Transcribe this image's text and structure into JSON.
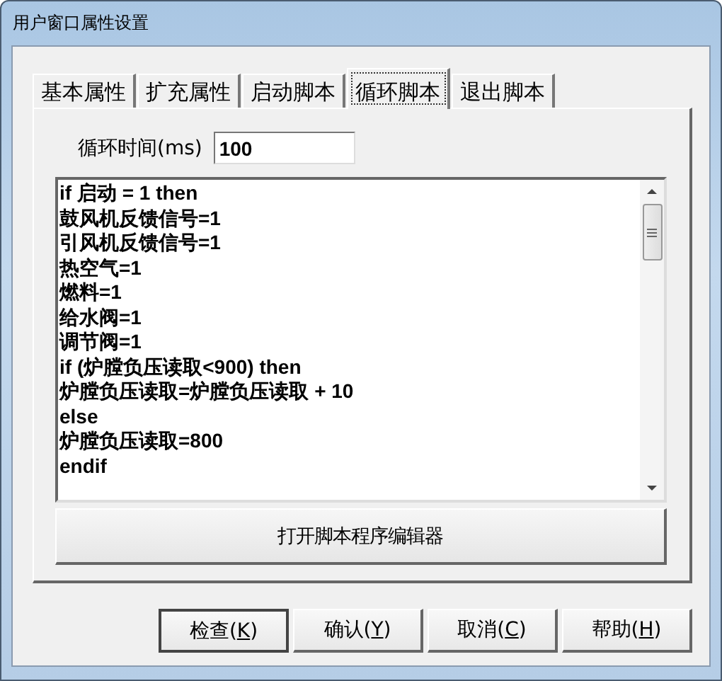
{
  "window": {
    "title": "用户窗口属性设置"
  },
  "tabs": [
    {
      "label": "基本属性",
      "selected": false
    },
    {
      "label": "扩充属性",
      "selected": false
    },
    {
      "label": "启动脚本",
      "selected": false
    },
    {
      "label": "循环脚本",
      "selected": true
    },
    {
      "label": "退出脚本",
      "selected": false
    }
  ],
  "cycle_time": {
    "label": "循环时间(ms)",
    "value": "100"
  },
  "script_lines": [
    "if 启动 = 1 then",
    "鼓风机反馈信号=1",
    "引风机反馈信号=1",
    "热空气=1",
    "燃料=1",
    "给水阀=1",
    "调节阀=1",
    "if (炉膛负压读取<900) then",
    "炉膛负压读取=炉膛负压读取 + 10",
    "else",
    "炉膛负压读取=800",
    "endif"
  ],
  "open_editor_button": "打开脚本程序编辑器",
  "buttons": [
    {
      "label": "检查(",
      "key": "K",
      "tail": ")",
      "default": true
    },
    {
      "label": "确认(",
      "key": "Y",
      "tail": ")",
      "default": false
    },
    {
      "label": "取消(",
      "key": "C",
      "tail": ")",
      "default": false
    },
    {
      "label": "帮助(",
      "key": "H",
      "tail": ")",
      "default": false
    }
  ]
}
